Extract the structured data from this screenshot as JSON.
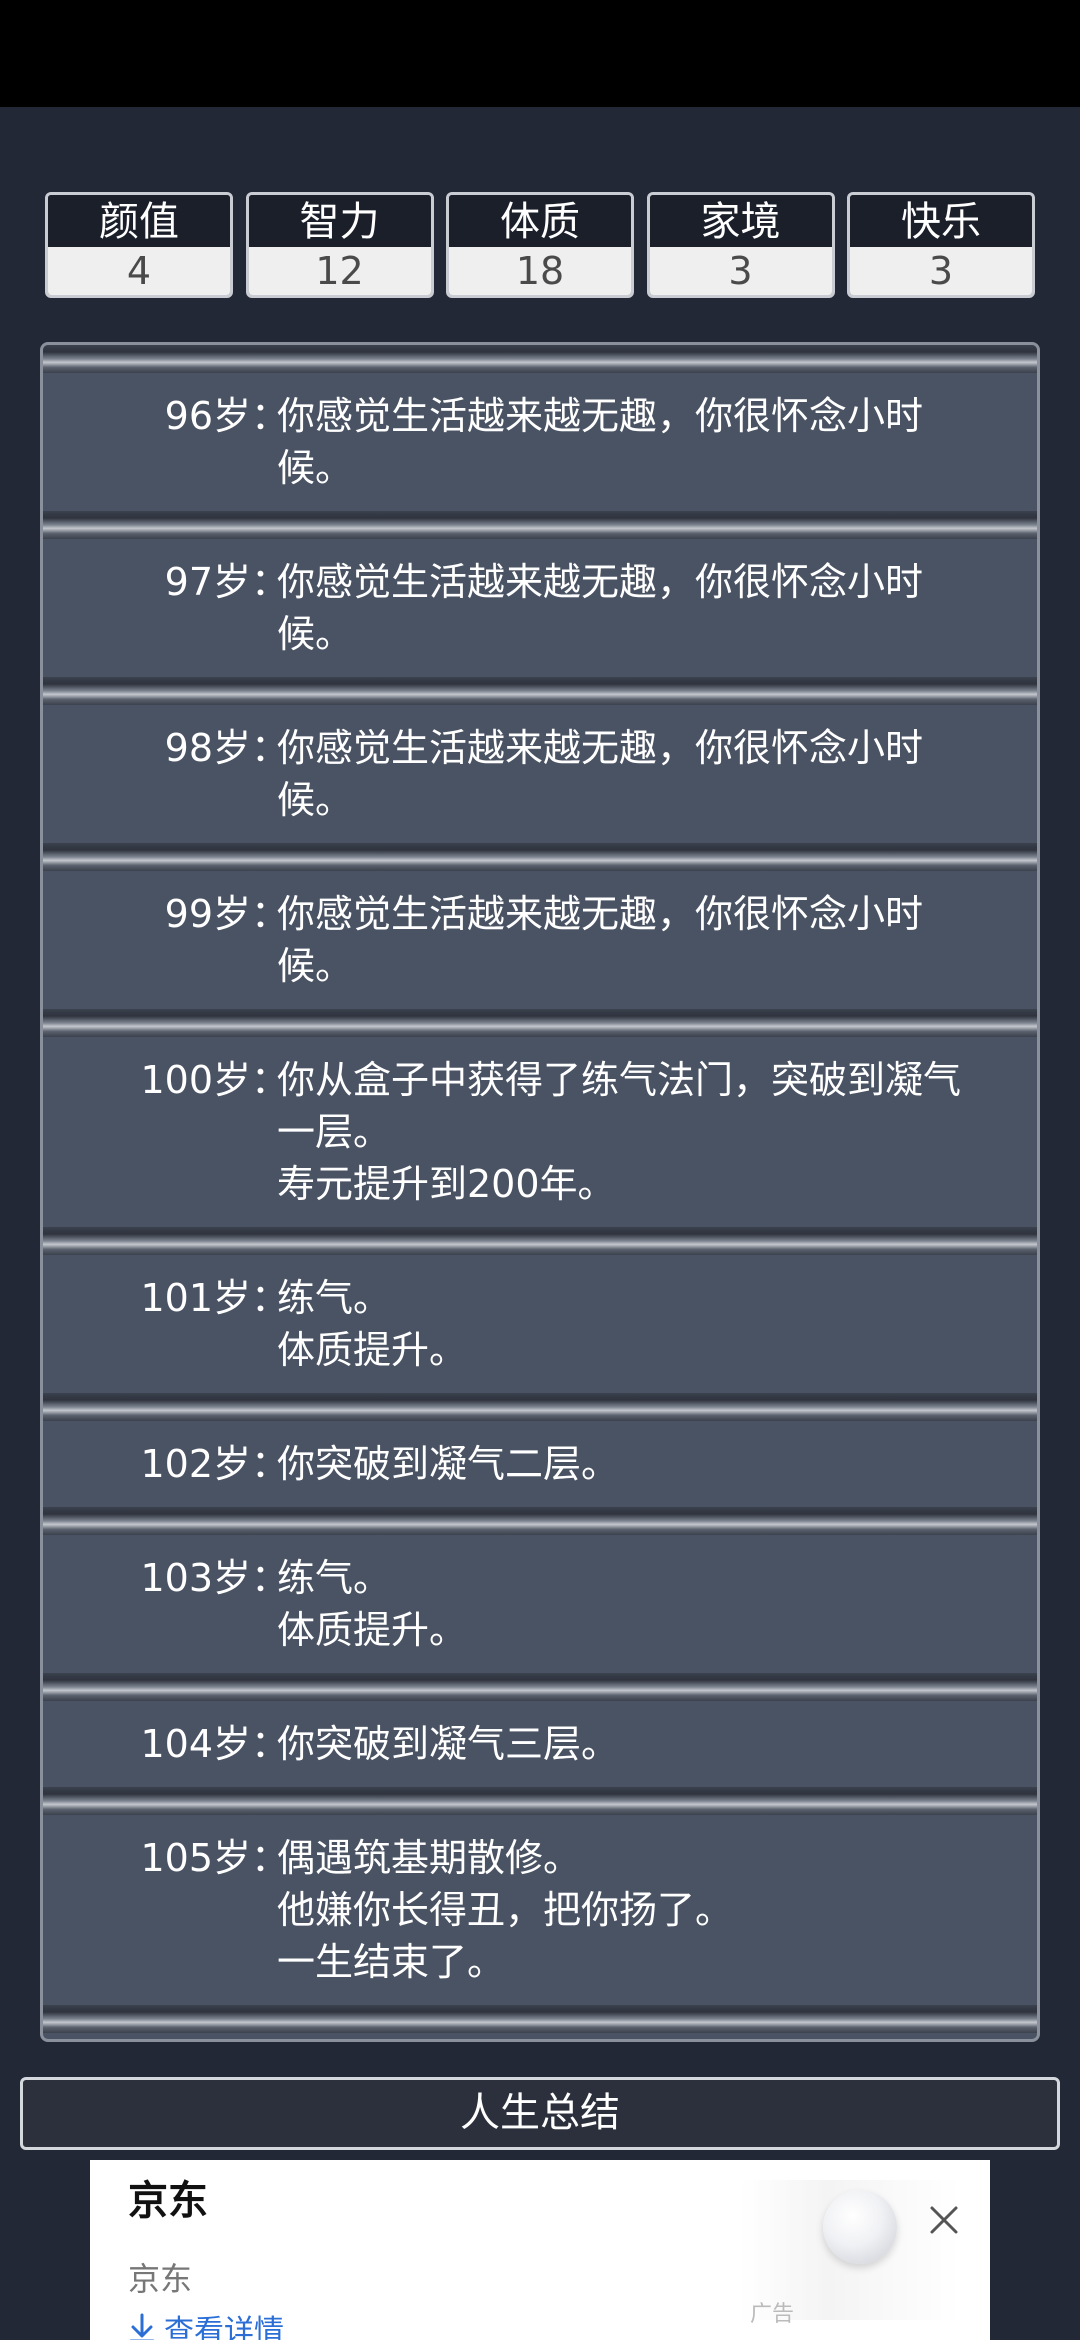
{
  "stats": [
    {
      "label": "颜值",
      "value": "4"
    },
    {
      "label": "智力",
      "value": "12"
    },
    {
      "label": "体质",
      "value": "18"
    },
    {
      "label": "家境",
      "value": "3"
    },
    {
      "label": "快乐",
      "value": "3"
    }
  ],
  "colon": "：",
  "entries": [
    {
      "age": "96岁",
      "lines": [
        "你感觉生活越来越无趣，你很怀念小时",
        "候。"
      ]
    },
    {
      "age": "97岁",
      "lines": [
        "你感觉生活越来越无趣，你很怀念小时",
        "候。"
      ]
    },
    {
      "age": "98岁",
      "lines": [
        "你感觉生活越来越无趣，你很怀念小时",
        "候。"
      ]
    },
    {
      "age": "99岁",
      "lines": [
        "你感觉生活越来越无趣，你很怀念小时",
        "候。"
      ]
    },
    {
      "age": "100岁",
      "lines": [
        "你从盒子中获得了练气法门，突破到凝气",
        "一层。",
        "寿元提升到200年。"
      ]
    },
    {
      "age": "101岁",
      "lines": [
        "练气。",
        "体质提升。"
      ]
    },
    {
      "age": "102岁",
      "lines": [
        "你突破到凝气二层。"
      ]
    },
    {
      "age": "103岁",
      "lines": [
        "练气。",
        "体质提升。"
      ]
    },
    {
      "age": "104岁",
      "lines": [
        "你突破到凝气三层。"
      ]
    },
    {
      "age": "105岁",
      "lines": [
        "偶遇筑基期散修。",
        "他嫌你长得丑，把你扬了。",
        "一生结束了。"
      ]
    }
  ],
  "summary_button": "人生总结",
  "ad": {
    "title": "京东",
    "subtitle": "京东",
    "link": "查看详情",
    "tag": "广告",
    "close_icon": "close-icon",
    "link_icon": "download-icon",
    "link_color": "#2b6fd6"
  }
}
